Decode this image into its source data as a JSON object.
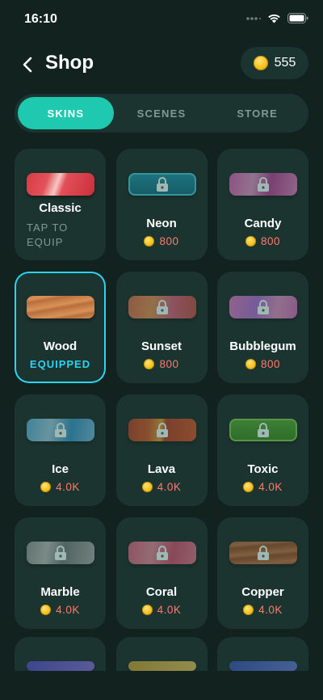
{
  "status": {
    "time": "16:10"
  },
  "header": {
    "title": "Shop",
    "coins": "555"
  },
  "tabs": [
    {
      "label": "SKINS",
      "active": true
    },
    {
      "label": "SCENES",
      "active": false
    },
    {
      "label": "STORE",
      "active": false
    }
  ],
  "skins": [
    {
      "name": "Classic",
      "status": "TAP TO EQUIP"
    },
    {
      "name": "Neon",
      "price": "800"
    },
    {
      "name": "Candy",
      "price": "800"
    },
    {
      "name": "Wood",
      "status": "EQUIPPED"
    },
    {
      "name": "Sunset",
      "price": "800"
    },
    {
      "name": "Bubblegum",
      "price": "800"
    },
    {
      "name": "Ice",
      "price": "4.0K"
    },
    {
      "name": "Lava",
      "price": "4.0K"
    },
    {
      "name": "Toxic",
      "price": "4.0K"
    },
    {
      "name": "Marble",
      "price": "4.0K"
    },
    {
      "name": "Coral",
      "price": "4.0K"
    },
    {
      "name": "Copper",
      "price": "4.0K"
    }
  ],
  "colors": {
    "accent": "#1fc9b0",
    "equipped": "#2bd4f0",
    "price": "#ff7a6e",
    "background": "#11221f",
    "card": "#1c3430"
  }
}
